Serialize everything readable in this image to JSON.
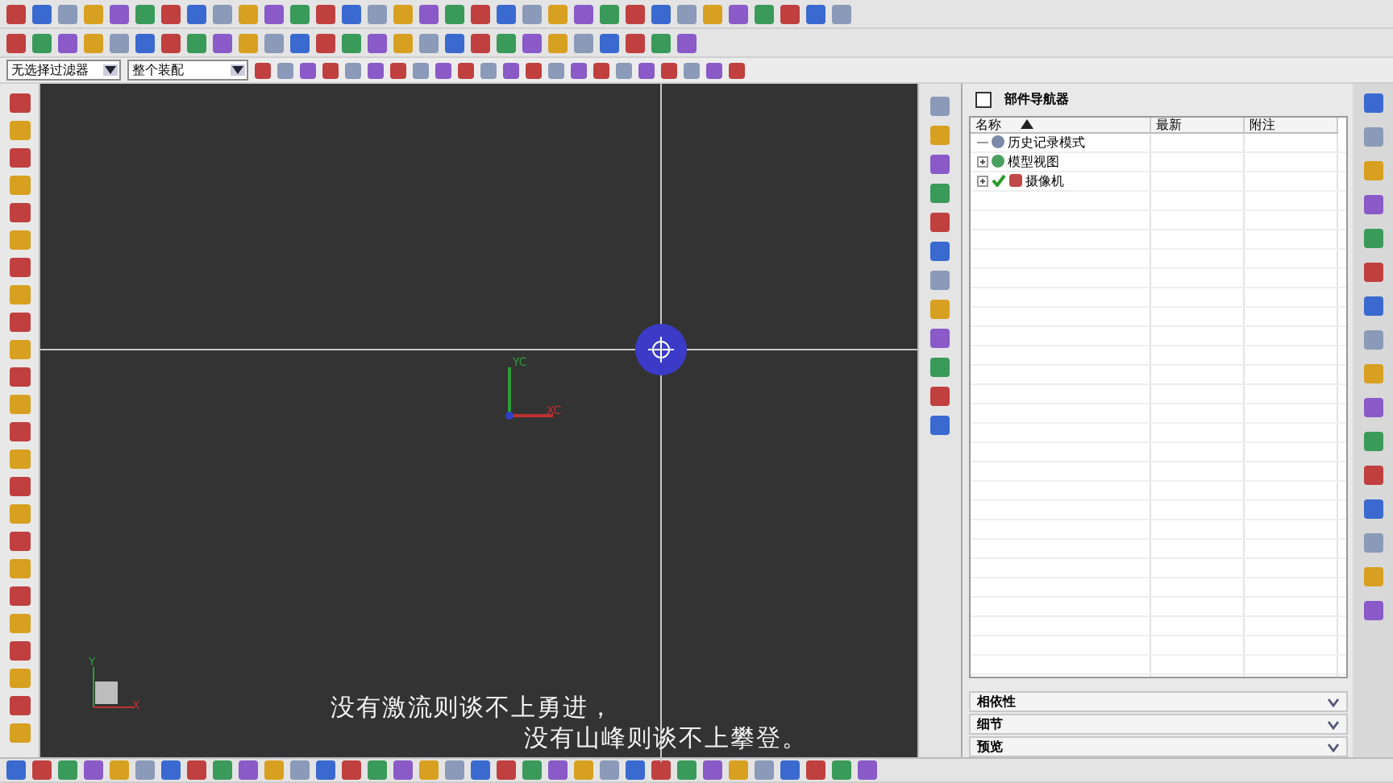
{
  "filters": [
    {
      "value": "无选择过滤器"
    },
    {
      "value": "整个装配"
    }
  ],
  "viewport": {
    "axis_labels": [
      "YC",
      "XC"
    ],
    "mini_triad_labels": [
      "Y",
      "X"
    ]
  },
  "navigator": {
    "title": "部件导航器",
    "columns": [
      "名称",
      "最新",
      "附注"
    ],
    "rows": [
      {
        "label": "历史记录模式",
        "checked": false
      },
      {
        "label": "模型视图",
        "expanded": false,
        "checked": false
      },
      {
        "label": "摄像机",
        "expanded": false,
        "checked": true
      }
    ],
    "sections": [
      {
        "label": "相依性",
        "expanded": false
      },
      {
        "label": "细节",
        "expanded": false
      },
      {
        "label": "预览",
        "expanded": false
      }
    ]
  },
  "subtitles": [
    "没有激流则谈不上勇进，",
    "没有山峰则谈不上攀登。"
  ]
}
